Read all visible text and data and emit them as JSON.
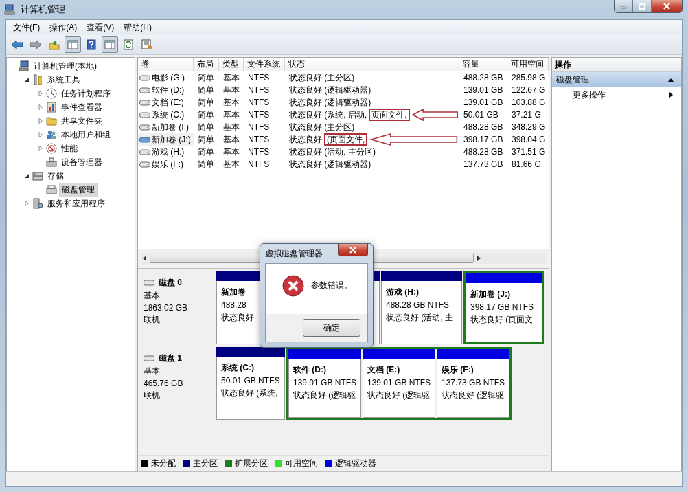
{
  "window": {
    "title": "计算机管理"
  },
  "menu": [
    "文件(F)",
    "操作(A)",
    "查看(V)",
    "帮助(H)"
  ],
  "toolbar": [
    {
      "pressed": false
    },
    {
      "pressed": false
    },
    {
      "pressed": false
    },
    {
      "pressed": true
    },
    {
      "pressed": false
    },
    {
      "pressed": true
    },
    {
      "pressed": false
    },
    {
      "pressed": false
    }
  ],
  "tree": [
    {
      "label": "计算机管理(本地)",
      "kind": "root",
      "selected": false,
      "children": [
        {
          "label": "系统工具",
          "kind": "node",
          "expanded": true,
          "selected": false,
          "children": [
            {
              "label": "任务计划程序",
              "kind": "node",
              "expanded": false,
              "selected": false
            },
            {
              "label": "事件查看器",
              "kind": "node",
              "expanded": false,
              "selected": false
            },
            {
              "label": "共享文件夹",
              "kind": "node",
              "expanded": false,
              "selected": false
            },
            {
              "label": "本地用户和组",
              "kind": "node",
              "expanded": false,
              "selected": false
            },
            {
              "label": "性能",
              "kind": "node",
              "expanded": false,
              "selected": false
            },
            {
              "label": "设备管理器",
              "kind": "leaf",
              "selected": false
            }
          ]
        },
        {
          "label": "存储",
          "kind": "node",
          "expanded": true,
          "selected": false,
          "children": [
            {
              "label": "磁盘管理",
              "kind": "leaf",
              "selected": true
            }
          ]
        },
        {
          "label": "服务和应用程序",
          "kind": "node",
          "expanded": false,
          "selected": false
        }
      ]
    }
  ],
  "volumes": {
    "columns": [
      "卷",
      "布局",
      "类型",
      "文件系统",
      "状态",
      "容量",
      "可用空间"
    ],
    "rows": [
      {
        "cells": [
          "电影 (G:)",
          "简单",
          "基本",
          "NTFS",
          "状态良好 (主分区)",
          "488.28 GB",
          "285.98 G"
        ],
        "selected": false
      },
      {
        "cells": [
          "软件 (D:)",
          "简单",
          "基本",
          "NTFS",
          "状态良好 (逻辑驱动器)",
          "139.01 GB",
          "122.67 G"
        ],
        "selected": false
      },
      {
        "cells": [
          "文档 (E:)",
          "简单",
          "基本",
          "NTFS",
          "状态良好 (逻辑驱动器)",
          "139.01 GB",
          "103.88 G"
        ],
        "selected": false
      },
      {
        "cells": [
          "系统 (C:)",
          "简单",
          "基本",
          "NTFS",
          [
            {
              "text": "状态良好 (系统, 启动,",
              "boxed": false
            },
            {
              "text": "页面文件,",
              "boxed": true
            }
          ],
          "50.01 GB",
          "37.21 G"
        ],
        "selected": false
      },
      {
        "cells": [
          "新加卷 (I:)",
          "简单",
          "基本",
          "NTFS",
          "状态良好 (主分区)",
          "488.28 GB",
          "348.29 G"
        ],
        "selected": false
      },
      {
        "cells": [
          "新加卷 (J:)",
          "简单",
          "基本",
          "NTFS",
          [
            {
              "text": "状态良好",
              "boxed": false
            },
            {
              "text": "(页面文件,",
              "boxed": true
            }
          ],
          "398.17 GB",
          "398.04 G"
        ],
        "selected": true
      },
      {
        "cells": [
          "游戏 (H:)",
          "简单",
          "基本",
          "NTFS",
          "状态良好 (活动, 主分区)",
          "488.28 GB",
          "371.51 G"
        ],
        "selected": false
      },
      {
        "cells": [
          "娱乐 (F:)",
          "简单",
          "基本",
          "NTFS",
          "状态良好 (逻辑驱动器)",
          "137.73 GB",
          "81.66 G"
        ],
        "selected": false
      }
    ]
  },
  "disks": [
    {
      "name": "磁盘 0",
      "type": "基本",
      "size": "1863.02 GB",
      "status": "联机",
      "partitions": [
        {
          "kind": "primary",
          "name": "新加卷",
          "size": "488.28",
          "status": "状态良好"
        },
        {
          "kind": "primary"
        },
        {
          "kind": "primary",
          "name": "游戏 (H:)",
          "size": "488.28 GB NTFS",
          "status": "状态良好 (活动, 主"
        },
        {
          "kind": "extended",
          "children": [
            {
              "kind": "logical",
              "name": "新加卷 (J:)",
              "size": "398.17 GB NTFS",
              "status": "状态良好 (页面文"
            }
          ]
        }
      ]
    },
    {
      "name": "磁盘 1",
      "type": "基本",
      "size": "465.76 GB",
      "status": "联机",
      "partitions": [
        {
          "kind": "primary",
          "name": "系统 (C:)",
          "size": "50.01 GB NTFS",
          "status": "状态良好 (系统,"
        },
        {
          "kind": "extended",
          "children": [
            {
              "kind": "logical",
              "name": "软件 (D:)",
              "size": "139.01 GB NTFS",
              "status": "状态良好 (逻辑驱"
            },
            {
              "kind": "logical",
              "name": "文档 (E:)",
              "size": "139.01 GB NTFS",
              "status": "状态良好 (逻辑驱"
            },
            {
              "kind": "logical",
              "name": "娱乐 (F:)",
              "size": "137.73 GB NTFS",
              "status": "状态良好 (逻辑驱"
            }
          ]
        }
      ]
    }
  ],
  "legend": [
    {
      "label": "未分配",
      "color": "#000000"
    },
    {
      "label": "主分区",
      "color": "#000080"
    },
    {
      "label": "扩展分区",
      "color": "#1e7a1e"
    },
    {
      "label": "可用空间",
      "color": "#33dd33"
    },
    {
      "label": "逻辑驱动器",
      "color": "#0000e0"
    }
  ],
  "actions": {
    "title": "操作",
    "section": {
      "label": "磁盘管理",
      "expanded": true
    },
    "items": [
      "更多操作"
    ]
  },
  "dialog": {
    "title": "虚拟磁盘管理器",
    "message": "参数错误。",
    "button": "确定"
  }
}
